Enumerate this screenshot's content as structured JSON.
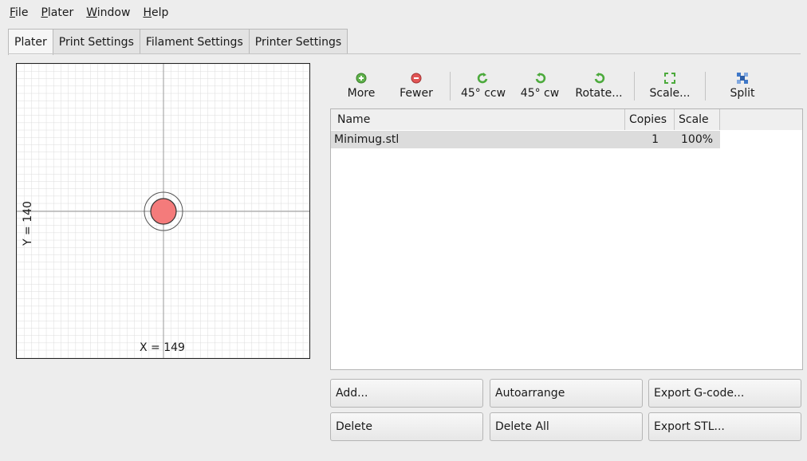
{
  "menu": [
    "File",
    "Plater",
    "Window",
    "Help"
  ],
  "menu_mnemonic": [
    "F",
    "P",
    "W",
    "H"
  ],
  "tabs": [
    "Plater",
    "Print Settings",
    "Filament Settings",
    "Printer Settings"
  ],
  "active_tab": "Plater",
  "plate": {
    "x_label": "X = 149",
    "y_label": "Y = 140",
    "object_color": "#f47b7b"
  },
  "toolbar": [
    {
      "label": "More",
      "icon": "add-icon"
    },
    {
      "label": "Fewer",
      "icon": "remove-icon"
    },
    {
      "label": "45° ccw",
      "icon": "rotate-ccw-icon"
    },
    {
      "label": "45° cw",
      "icon": "rotate-cw-icon"
    },
    {
      "label": "Rotate...",
      "icon": "rotate-icon"
    },
    {
      "label": "Scale...",
      "icon": "scale-icon"
    },
    {
      "label": "Split",
      "icon": "split-icon"
    }
  ],
  "object_list": {
    "columns": [
      "Name",
      "Copies",
      "Scale"
    ],
    "rows": [
      {
        "name": "Minimug.stl",
        "copies": "1",
        "scale": "100%"
      }
    ]
  },
  "actions": {
    "add": "Add...",
    "autoarrange": "Autoarrange",
    "export_gcode": "Export G-code...",
    "delete": "Delete",
    "delete_all": "Delete All",
    "export_stl": "Export STL..."
  }
}
